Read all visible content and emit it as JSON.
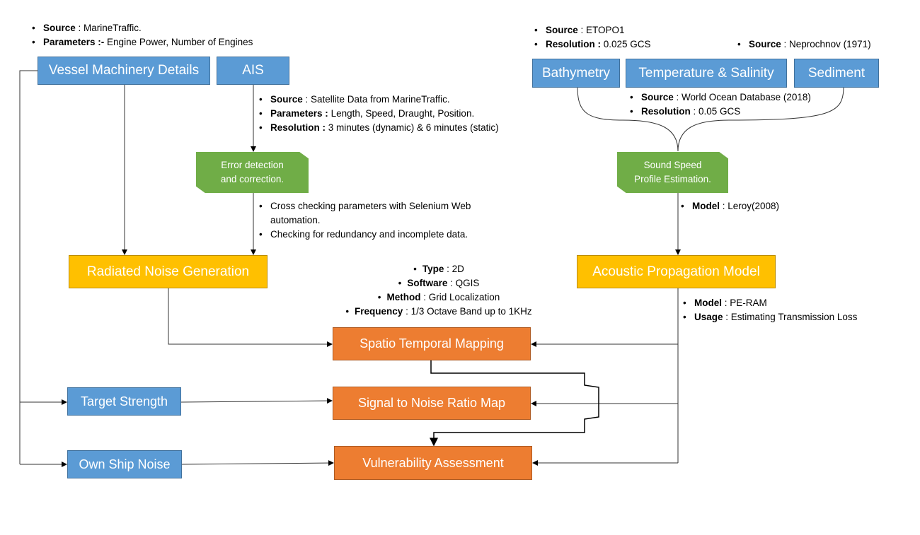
{
  "boxes": {
    "vessel": "Vessel Machinery Details",
    "ais": "AIS",
    "bathymetry": "Bathymetry",
    "temp_salinity": "Temperature & Salinity",
    "sediment": "Sediment",
    "error_detection": [
      "Error detection",
      "and correction."
    ],
    "sound_speed": [
      "Sound Speed",
      "Profile Estimation."
    ],
    "radiated_noise": "Radiated Noise Generation",
    "acoustic_model": "Acoustic Propagation Model",
    "spatio": "Spatio Temporal Mapping",
    "snr": "Signal to Noise Ratio Map",
    "vulnerability": "Vulnerability Assessment",
    "target_strength": "Target Strength",
    "own_ship": "Own Ship Noise"
  },
  "notes": {
    "vessel": [
      {
        "k": "Source",
        "v": " : MarineTraffic."
      },
      {
        "k": "Parameters :-",
        "v": " Engine Power, Number of Engines"
      }
    ],
    "ais": [
      {
        "k": "Source",
        "v": " : Satellite Data from MarineTraffic."
      },
      {
        "k": "Parameters :",
        "v": " Length, Speed, Draught, Position."
      },
      {
        "k": "Resolution :",
        "v": " 3 minutes (dynamic) & 6 minutes (static)"
      }
    ],
    "error": [
      {
        "k": "",
        "v": "Cross checking parameters with Selenium Web"
      },
      {
        "k": "",
        "v": "automation."
      },
      {
        "k": "",
        "v": "Checking for redundancy and incomplete data."
      }
    ],
    "bathymetry": [
      {
        "k": "Source",
        "v": " : ETOPO1"
      },
      {
        "k": "Resolution :",
        "v": " 0.025 GCS"
      }
    ],
    "sediment": [
      {
        "k": "Source",
        "v": " : Neprochnov (1971)"
      }
    ],
    "temp_salinity": [
      {
        "k": "Source",
        "v": " : World Ocean Database (2018)"
      },
      {
        "k": "Resolution",
        "v": " : 0.05 GCS"
      }
    ],
    "sound_speed": [
      {
        "k": "Model",
        "v": " : Leroy(2008)"
      }
    ],
    "mapping": [
      {
        "k": "Type",
        "v": " : 2D"
      },
      {
        "k": "Software",
        "v": " : QGIS"
      },
      {
        "k": "Method",
        "v": " : Grid Localization"
      },
      {
        "k": "Frequency",
        "v": " : 1/3 Octave Band up to 1KHz"
      }
    ],
    "acoustic": [
      {
        "k": "Model",
        "v": " : PE-RAM"
      },
      {
        "k": "Usage",
        "v": " : Estimating Transmission Loss"
      }
    ]
  },
  "colors": {
    "input": "#5b9bd5",
    "process": "#70ad47",
    "model": "#ffc000",
    "output": "#ed7d31"
  }
}
